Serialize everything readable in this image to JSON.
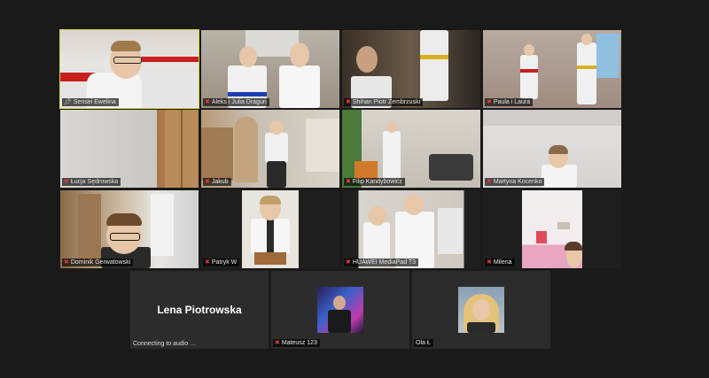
{
  "participants": [
    {
      "name": "Sensei Ewelina",
      "muted": false,
      "pinned": true,
      "active": true,
      "icon": "pin-icon"
    },
    {
      "name": "Aleks i Julia Dragun",
      "muted": true
    },
    {
      "name": "Shihan Piotr Zembrzuski",
      "muted": true
    },
    {
      "name": "Paula i Laura",
      "muted": true
    },
    {
      "name": "Łucja Sędrowska",
      "muted": true
    },
    {
      "name": "Jakub",
      "muted": true
    },
    {
      "name": "Filip Kandybowicz",
      "muted": true
    },
    {
      "name": "Martyna Kocenko",
      "muted": true
    },
    {
      "name": "Dominik Gerwatowski",
      "muted": true
    },
    {
      "name": "Patryk W",
      "muted": true
    },
    {
      "name": "HUAWEI MediaPad T3",
      "muted": true
    },
    {
      "name": "Milena",
      "muted": true
    }
  ],
  "video_off": [
    {
      "display_name": "Lena Piotrowska",
      "status": "Connecting to audio"
    },
    {
      "name": "Mateusz 123",
      "muted": true
    },
    {
      "name": "Ola Ł",
      "muted": false
    }
  ],
  "icons": {
    "mic_muted": "mic-muted-icon",
    "connecting": "connecting-icon"
  },
  "colors": {
    "background": "#1a1a1a",
    "tile": "#2c2c2c",
    "active_speaker": "#d6d63a",
    "muted_mic": "#e03a3a"
  }
}
